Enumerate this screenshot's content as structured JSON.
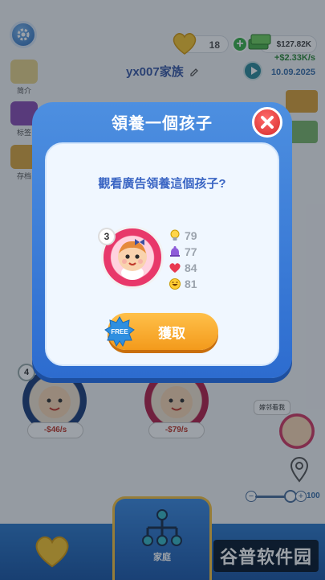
{
  "hud": {
    "gem_count": "18",
    "money": "$127.82K",
    "income": "+$2.33K/s",
    "date": "10.09.2025",
    "family_name": "yx007家族"
  },
  "sidebar": {
    "items": [
      {
        "label": "简介"
      },
      {
        "label": "标签"
      },
      {
        "label": "存档"
      }
    ]
  },
  "scene": {
    "child_left": {
      "level": "4",
      "cost": "-$46/s"
    },
    "child_mid": {
      "cost": "-$79/s"
    },
    "speech": "嫁邻看我",
    "zoom": "100"
  },
  "modal": {
    "title": "領養一個孩子",
    "question": "觀看廣告領養這個孩子?",
    "child_level": "3",
    "stats": {
      "intelligence": "79",
      "status": "77",
      "health": "84",
      "happiness": "81"
    },
    "free_badge": "FREE",
    "adopt_label": "獲取"
  },
  "bottom_nav": {
    "family_label": "家庭"
  },
  "watermark": "谷普软件园",
  "colors": {
    "modal_blue": "#2d6ccf",
    "button_orange": "#f39a1c",
    "close_red": "#d62b2b",
    "portrait_pink": "#e8386a"
  }
}
